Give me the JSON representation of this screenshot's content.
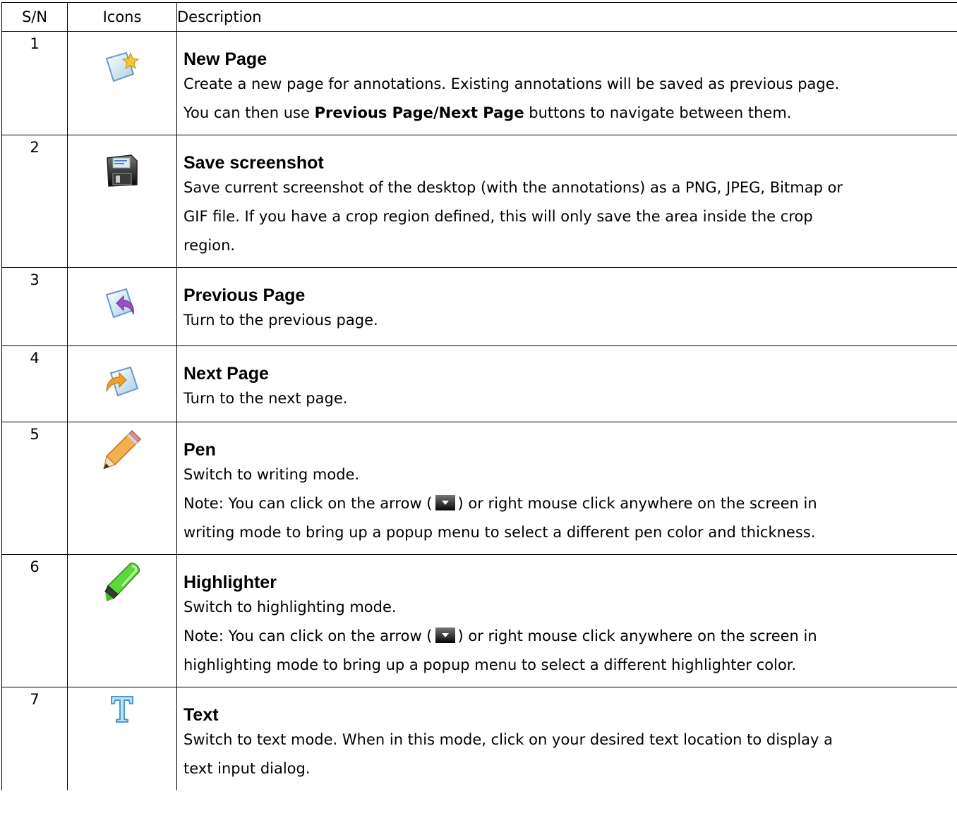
{
  "headers": {
    "sn": "S/N",
    "icons": "Icons",
    "description": "Description"
  },
  "rows": [
    {
      "sn": "1",
      "icon": "new-page-icon",
      "title": "New Page",
      "line1": "Create a new page for annotations. Existing annotations will be saved as previous page.",
      "line2_pre": "You can then use ",
      "line2_b1": "Previous Page",
      "line2_slash": "/",
      "line2_b2": "Next Page",
      "line2_post": " buttons to navigate between them."
    },
    {
      "sn": "2",
      "icon": "save-screenshot-icon",
      "title": "Save screenshot",
      "line1": "Save current screenshot of the desktop (with the annotations) as a PNG, JPEG, Bitmap or",
      "line2": "GIF file. If you have a crop region defined, this will only save the area inside the crop",
      "line3": "region."
    },
    {
      "sn": "3",
      "icon": "previous-page-icon",
      "title": "Previous Page",
      "line1": "Turn to the previous page."
    },
    {
      "sn": "4",
      "icon": "next-page-icon",
      "title": "Next Page",
      "line1": "Turn to the next page."
    },
    {
      "sn": "5",
      "icon": "pen-icon",
      "title": "Pen",
      "line1": "Switch to writing mode.",
      "note_pre": "Note: You can click on the arrow (",
      "note_post": ") or right mouse click anywhere on the screen in",
      "line3": "writing mode to bring up a popup menu to select a different pen color and thickness."
    },
    {
      "sn": "6",
      "icon": "highlighter-icon",
      "title": "Highlighter",
      "line1": "Switch to highlighting mode.",
      "note_pre": "Note: You can click on the arrow (",
      "note_post": ") or right mouse click anywhere on the screen in",
      "line3": "highlighting mode to bring up a popup menu to select a different highlighter color."
    },
    {
      "sn": "7",
      "icon": "text-tool-icon",
      "title": "Text",
      "line1": "Switch to text mode. When in this mode, click on your desired text location to display a",
      "line2": "text input dialog."
    }
  ]
}
